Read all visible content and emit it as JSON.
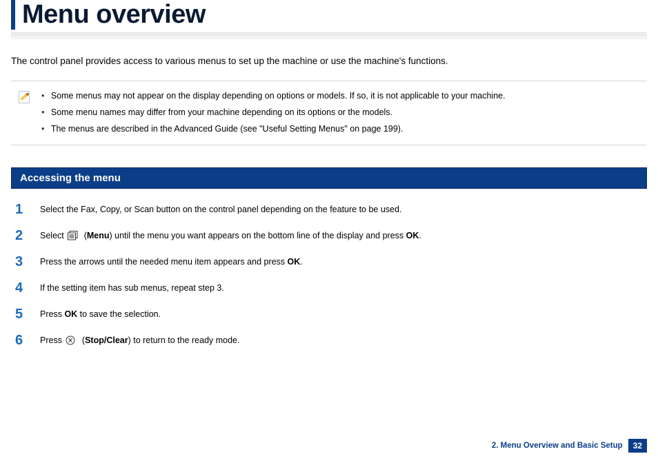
{
  "title": "Menu overview",
  "intro": "The control panel provides access to various menus to set up the machine or use the machine's functions.",
  "notes": [
    "Some menus may not appear on the display depending on options or models. If so, it is not applicable to your machine.",
    "Some menu names may differ from your machine depending on its options or the models.",
    "The menus are described in the Advanced Guide (see \"Useful Setting Menus\" on page 199)."
  ],
  "section_heading": "Accessing the menu",
  "steps": {
    "s1": "Select the Fax, Copy, or Scan button on the control panel depending on the feature to be used.",
    "s2_a": "Select ",
    "s2_menu": "Menu",
    "s2_b": ") until the menu you want appears on the bottom line of the display and press ",
    "s2_ok": "OK",
    "s2_c": ".",
    "s3_a": "Press the arrows until the needed menu item appears and press ",
    "s3_ok": "OK",
    "s3_b": ".",
    "s4": "If the setting item has sub menus, repeat step 3.",
    "s5_a": "Press ",
    "s5_ok": "OK",
    "s5_b": " to save the selection.",
    "s6_a": "Press ",
    "s6_stop": "Stop/Clear",
    "s6_b": ") to return to the ready mode."
  },
  "footer": {
    "chapter": "2. Menu Overview and Basic Setup",
    "page": "32"
  }
}
